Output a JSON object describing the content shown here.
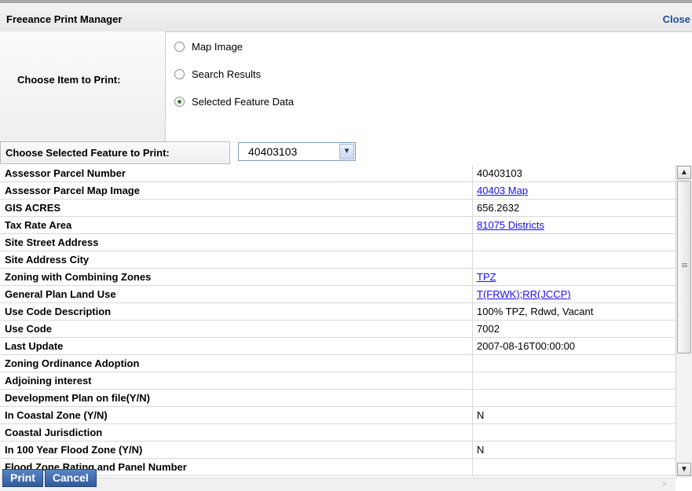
{
  "header": {
    "title": "Freeance Print Manager",
    "close_label": "Close"
  },
  "print_options": {
    "label": "Choose Item to Print:",
    "options": [
      {
        "label": "Map Image",
        "checked": false
      },
      {
        "label": "Search Results",
        "checked": false
      },
      {
        "label": "Selected Feature Data",
        "checked": true
      }
    ]
  },
  "feature_select": {
    "label": "Choose Selected Feature to Print:",
    "value": "40403103"
  },
  "table": {
    "rows": [
      {
        "name": "Assessor Parcel Number",
        "value": "40403103",
        "link": false
      },
      {
        "name": "Assessor Parcel Map Image",
        "value": "40403 Map",
        "link": true
      },
      {
        "name": "GIS ACRES",
        "value": "656.2632",
        "link": false
      },
      {
        "name": "Tax Rate Area",
        "value": "81075 Districts",
        "link": true
      },
      {
        "name": "Site Street Address",
        "value": "",
        "link": false
      },
      {
        "name": "Site Address City",
        "value": "",
        "link": false
      },
      {
        "name": "Zoning with Combining Zones",
        "value": "TPZ",
        "link": true
      },
      {
        "name": "General Plan Land Use",
        "value": "T(FRWK);RR(JCCP)",
        "link": true
      },
      {
        "name": "Use Code Description",
        "value": "100% TPZ, Rdwd, Vacant",
        "link": false
      },
      {
        "name": "Use Code",
        "value": "7002",
        "link": false
      },
      {
        "name": "Last Update",
        "value": "2007-08-16T00:00:00",
        "link": false
      },
      {
        "name": "Zoning Ordinance Adoption",
        "value": "",
        "link": false
      },
      {
        "name": "Adjoining interest",
        "value": "",
        "link": false
      },
      {
        "name": "Development Plan on file(Y/N)",
        "value": "",
        "link": false
      },
      {
        "name": "In Coastal Zone (Y/N)",
        "value": "N",
        "link": false
      },
      {
        "name": "Coastal Jurisdiction",
        "value": "",
        "link": false
      },
      {
        "name": "In 100 Year Flood Zone (Y/N)",
        "value": "N",
        "link": false
      },
      {
        "name": "Flood Zone Rating and Panel Number",
        "value": "",
        "link": false
      }
    ]
  },
  "buttons": {
    "print_label": "Print",
    "cancel_label": "Cancel"
  },
  "scrollbar": {
    "up_icon": "arrow-up-icon",
    "down_icon": "arrow-down-icon",
    "grip_icon": "grip-icon",
    "right_icon": "arrow-right-icon"
  },
  "colors": {
    "link": "#1a0dff",
    "close": "#1f4f9a",
    "button": "#2f5b9c"
  }
}
